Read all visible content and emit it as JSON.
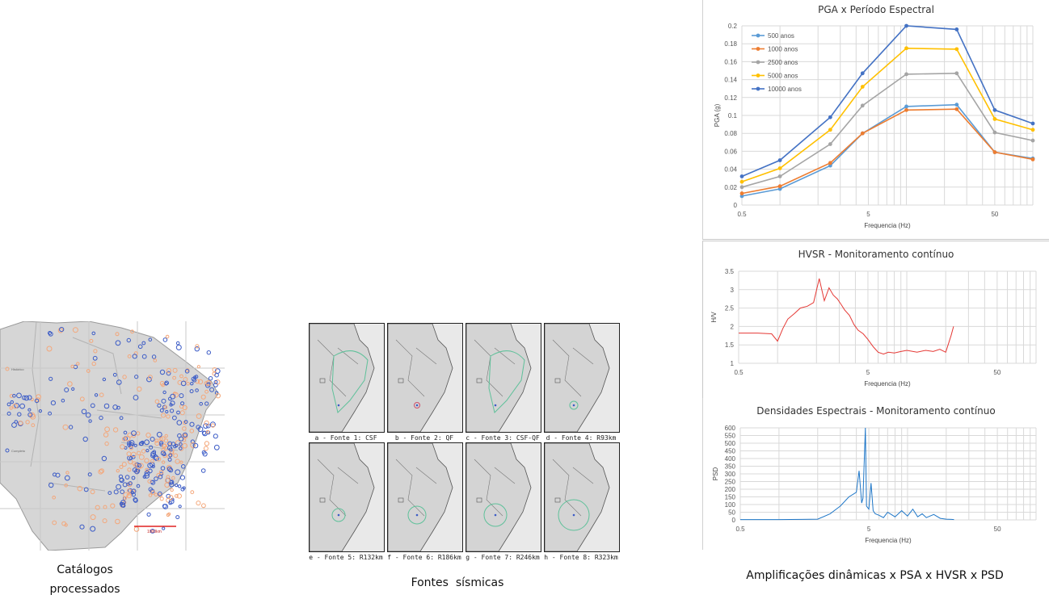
{
  "map_panel": {
    "legend": [
      "Histórico",
      "Completo"
    ],
    "scale_label": "1000km",
    "caption_line1": "Catálogos",
    "caption_line2": "processados"
  },
  "sources_panel": {
    "tiles": [
      {
        "label": "a - Fonte 1: CSF"
      },
      {
        "label": "b - Fonte 2: QF"
      },
      {
        "label": "c - Fonte 3: CSF-QF"
      },
      {
        "label": "d - Fonte 4: R93km"
      },
      {
        "label": "e - Fonte 5: R132km"
      },
      {
        "label": "f - Fonte 6: R186km"
      },
      {
        "label": "g - Fonte 7: R246km"
      },
      {
        "label": "h - Fonte 8: R323km"
      }
    ],
    "caption": "Fontes  sísmicas"
  },
  "right_caption": "Amplificações dinâmicas x PSA x HVSR x PSD",
  "chart_data": [
    {
      "type": "line",
      "title": "PGA x Período Espectral",
      "xlabel": "Frequencia (Hz)",
      "ylabel": "PGA (g)",
      "xscale": "log",
      "xlim": [
        0.5,
        100
      ],
      "xticks": [
        "0.5",
        "5",
        "50"
      ],
      "ylim": [
        0,
        0.2
      ],
      "yticks": [
        "0",
        "0.02",
        "0.04",
        "0.06",
        "0.08",
        "0.1",
        "0.12",
        "0.14",
        "0.16",
        "0.18",
        "0.2"
      ],
      "legend_position": "top-left",
      "x": [
        0.5,
        1,
        2.5,
        4.5,
        10,
        25,
        50,
        100
      ],
      "series": [
        {
          "name": "500 anos",
          "color": "#5b9bd5",
          "values": [
            0.01,
            0.018,
            0.044,
            0.08,
            0.11,
            0.112,
            0.059,
            0.052
          ]
        },
        {
          "name": "1000 anos",
          "color": "#ed7d31",
          "values": [
            0.013,
            0.021,
            0.047,
            0.08,
            0.106,
            0.107,
            0.059,
            0.051
          ]
        },
        {
          "name": "2500 anos",
          "color": "#a5a5a5",
          "values": [
            0.02,
            0.032,
            0.068,
            0.111,
            0.146,
            0.147,
            0.081,
            0.072
          ]
        },
        {
          "name": "5000 anos",
          "color": "#ffc000",
          "values": [
            0.026,
            0.041,
            0.084,
            0.132,
            0.175,
            0.174,
            0.096,
            0.084
          ]
        },
        {
          "name": "10000 anos",
          "color": "#4472c4",
          "values": [
            0.032,
            0.05,
            0.098,
            0.147,
            0.2,
            0.196,
            0.106,
            0.091
          ]
        }
      ]
    },
    {
      "type": "line",
      "title": "HVSR - Monitoramento contínuo",
      "xlabel": "Frequencia (Hz)",
      "ylabel": "H/V",
      "xscale": "log",
      "xlim": [
        0.5,
        100
      ],
      "xticks": [
        "0.5",
        "5",
        "50"
      ],
      "ylim": [
        1,
        3.5
      ],
      "yticks": [
        "1",
        "1.5",
        "2",
        "2.5",
        "3",
        "3.5"
      ],
      "series": [
        {
          "name": "",
          "color": "#e53935",
          "x": [
            0.5,
            0.7,
            0.9,
            1.0,
            1.1,
            1.2,
            1.35,
            1.5,
            1.7,
            1.9,
            2.1,
            2.3,
            2.5,
            2.7,
            2.9,
            3.1,
            3.3,
            3.6,
            3.9,
            4.2,
            4.6,
            5.0,
            5.5,
            6.0,
            6.6,
            7.2,
            8.0,
            9.0,
            10,
            12,
            14,
            16,
            18,
            20,
            22,
            23
          ],
          "values": [
            1.82,
            1.82,
            1.8,
            1.6,
            1.95,
            2.2,
            2.35,
            2.5,
            2.55,
            2.65,
            3.3,
            2.7,
            3.05,
            2.85,
            2.75,
            2.6,
            2.45,
            2.3,
            2.05,
            1.9,
            1.8,
            1.65,
            1.45,
            1.3,
            1.25,
            1.3,
            1.28,
            1.32,
            1.35,
            1.3,
            1.35,
            1.32,
            1.38,
            1.3,
            1.75,
            2.0
          ]
        }
      ]
    },
    {
      "type": "line",
      "title": "Densidades Espectrais - Monitoramento contínuo",
      "xlabel": "Frequencia (Hz)",
      "ylabel": "PSD",
      "xscale": "log",
      "xlim": [
        0.5,
        100
      ],
      "xticks": [
        "0.5",
        "5",
        "50"
      ],
      "ylim": [
        0,
        600
      ],
      "yticks": [
        "0",
        "50",
        "100",
        "150",
        "200",
        "250",
        "300",
        "350",
        "400",
        "450",
        "500",
        "550",
        "600"
      ],
      "series": [
        {
          "name": "",
          "color": "#1f77c8",
          "x": [
            0.5,
            1.0,
            1.5,
            2.0,
            2.5,
            3.0,
            3.5,
            4.0,
            4.2,
            4.4,
            4.5,
            4.7,
            4.8,
            5.0,
            5.2,
            5.4,
            5.6,
            6.0,
            6.5,
            7.0,
            8.0,
            9.0,
            10,
            11,
            12,
            13,
            14,
            16,
            18,
            20,
            22,
            23
          ],
          "values": [
            2,
            2,
            3,
            5,
            40,
            90,
            150,
            180,
            320,
            110,
            140,
            600,
            90,
            70,
            240,
            60,
            40,
            30,
            15,
            50,
            20,
            60,
            25,
            70,
            20,
            40,
            15,
            35,
            10,
            5,
            3,
            2
          ]
        }
      ]
    }
  ]
}
